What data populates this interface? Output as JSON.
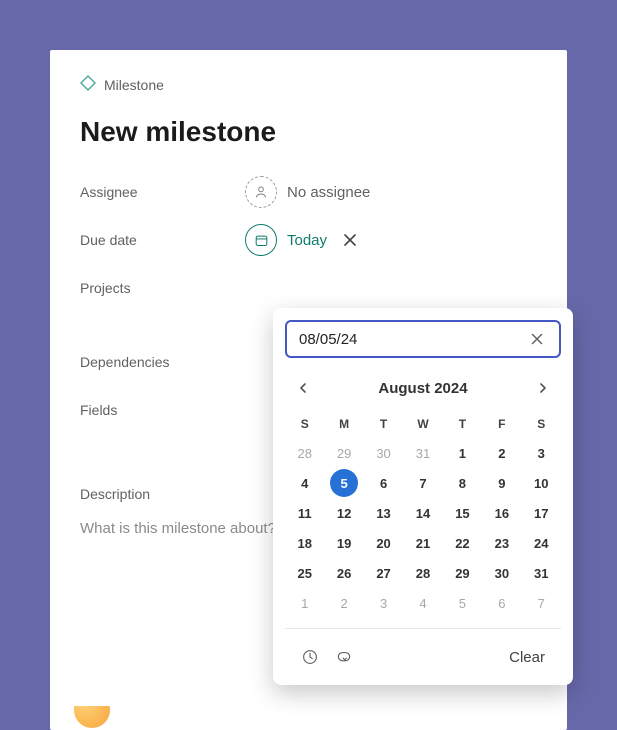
{
  "badge": {
    "label": "Milestone"
  },
  "title": "New milestone",
  "labels": {
    "assignee": "Assignee",
    "due_date": "Due date",
    "projects": "Projects",
    "dependencies": "Dependencies",
    "fields": "Fields",
    "description": "Description"
  },
  "assignee": {
    "value": "No assignee"
  },
  "due_date": {
    "value": "Today"
  },
  "description": {
    "placeholder": "What is this milestone about?"
  },
  "datepicker": {
    "input_value": "08/05/24",
    "month_label": "August 2024",
    "dow": [
      "S",
      "M",
      "T",
      "W",
      "T",
      "F",
      "S"
    ],
    "weeks": [
      [
        {
          "d": 28,
          "o": true
        },
        {
          "d": 29,
          "o": true
        },
        {
          "d": 30,
          "o": true
        },
        {
          "d": 31,
          "o": true
        },
        {
          "d": 1
        },
        {
          "d": 2
        },
        {
          "d": 3
        }
      ],
      [
        {
          "d": 4
        },
        {
          "d": 5,
          "sel": true
        },
        {
          "d": 6
        },
        {
          "d": 7
        },
        {
          "d": 8
        },
        {
          "d": 9
        },
        {
          "d": 10
        }
      ],
      [
        {
          "d": 11
        },
        {
          "d": 12
        },
        {
          "d": 13
        },
        {
          "d": 14
        },
        {
          "d": 15
        },
        {
          "d": 16
        },
        {
          "d": 17
        }
      ],
      [
        {
          "d": 18
        },
        {
          "d": 19
        },
        {
          "d": 20
        },
        {
          "d": 21
        },
        {
          "d": 22
        },
        {
          "d": 23
        },
        {
          "d": 24
        }
      ],
      [
        {
          "d": 25
        },
        {
          "d": 26
        },
        {
          "d": 27
        },
        {
          "d": 28
        },
        {
          "d": 29
        },
        {
          "d": 30
        },
        {
          "d": 31
        }
      ],
      [
        {
          "d": 1,
          "o": true
        },
        {
          "d": 2,
          "o": true
        },
        {
          "d": 3,
          "o": true
        },
        {
          "d": 4,
          "o": true
        },
        {
          "d": 5,
          "o": true
        },
        {
          "d": 6,
          "o": true
        },
        {
          "d": 7,
          "o": true
        }
      ]
    ],
    "clear_label": "Clear"
  }
}
